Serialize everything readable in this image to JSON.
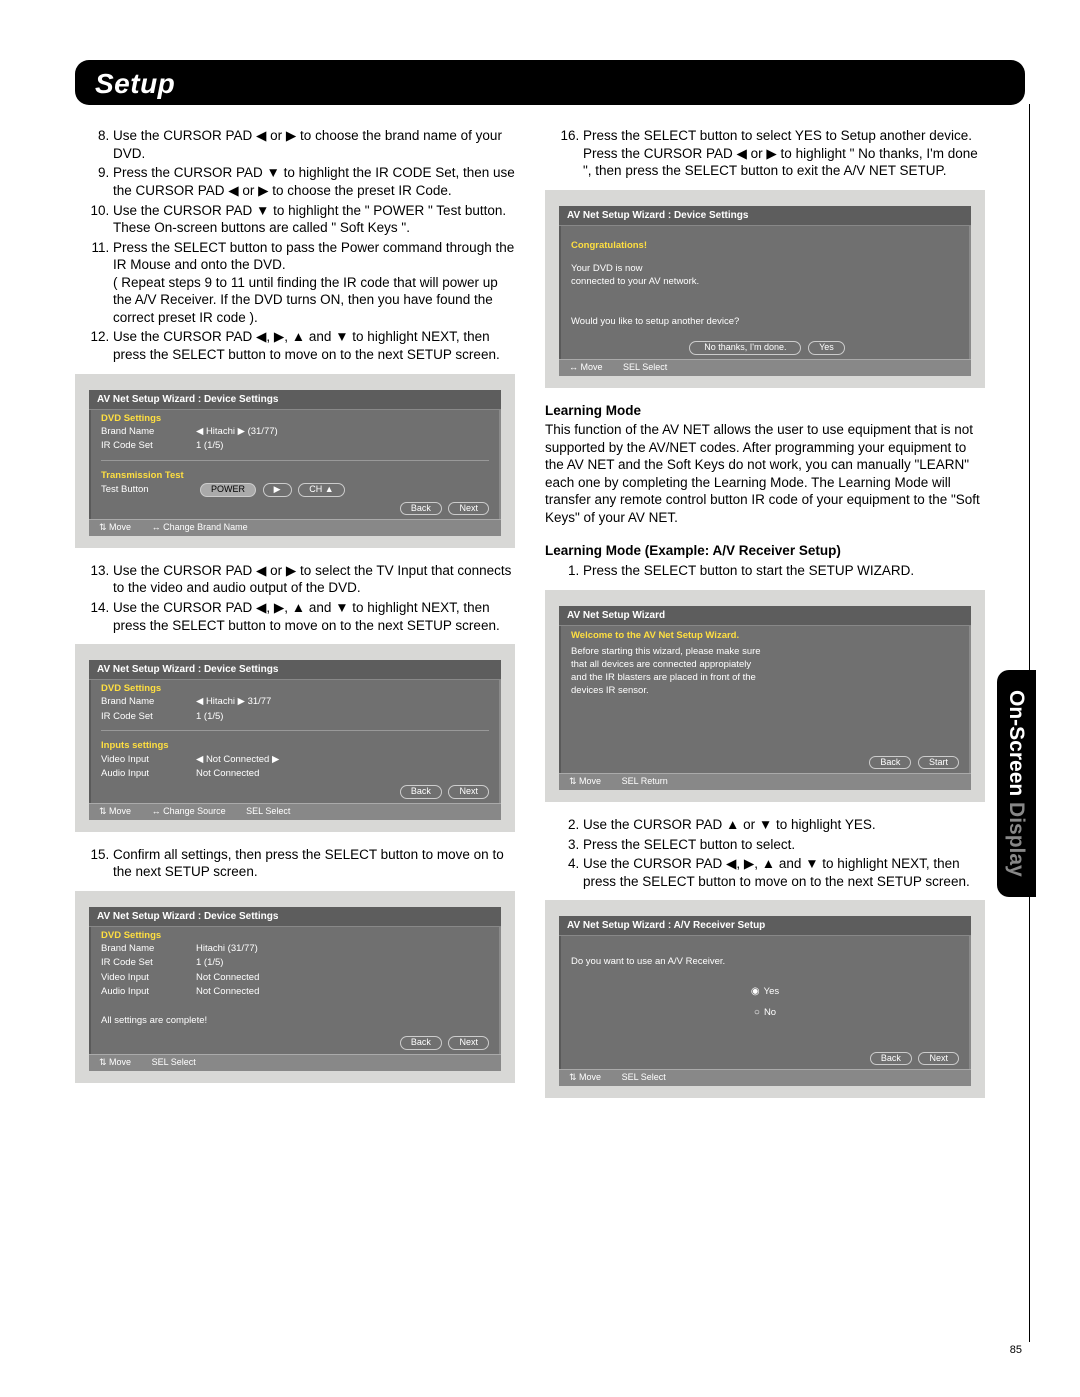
{
  "header": "Setup",
  "side_tab_a": "On-Screen",
  "side_tab_b": " Display",
  "page_num": "85",
  "steps_left_a": [
    "Use the CURSOR PAD ◀ or ▶ to choose the brand name of your DVD.",
    "Press the CURSOR PAD ▼ to highlight the IR CODE Set, then use the CURSOR PAD ◀ or ▶ to choose the preset IR Code.",
    "Use the CURSOR PAD ▼ to highlight the \" POWER \" Test button.",
    "Press the SELECT button to pass the Power command through the IR Mouse and onto the DVD.",
    "Use the CURSOR PAD ◀, ▶, ▲ and ▼ to highlight NEXT, then press the SELECT button to move on to the next SETUP screen."
  ],
  "step10_extra": "These On-screen buttons are called \" Soft Keys \".",
  "step11_extra": "( Repeat steps 9 to 11 until finding the IR code that will power up  the A/V Receiver. If the DVD turns ON, then you have found the correct preset IR code ).",
  "steps_left_b": [
    "Use the CURSOR PAD ◀ or ▶ to select the TV Input that connects to the video and audio output of the DVD.",
    "Use the CURSOR PAD ◀, ▶, ▲ and ▼ to highlight NEXT, then press the SELECT button to move on to the next SETUP screen."
  ],
  "steps_left_c": [
    "Confirm all settings, then  press the SELECT button to move on to the next SETUP screen."
  ],
  "step16": "Press the SELECT button to select YES to Setup another device.  Press the CURSOR PAD ◀ or ▶ to highlight \" No thanks, I'm done \", then press the SELECT button to exit the A/V NET SETUP.",
  "learning_title": "Learning Mode",
  "learning_body": "This function of the AV NET allows the user to  use equipment that is not supported by the AV/NET codes.  After programming your equipment to the AV NET and the Soft Keys do not work, you can manually \"LEARN\" each one by completing the Learning Mode.  The Learning Mode will transfer any remote control button IR code of your equipment to the \"Soft Keys\" of your AV NET.",
  "learning_ex_title": "Learning Mode (Example: A/V Receiver Setup)",
  "steps_right_a": [
    "Press the SELECT button to start the SETUP WIZARD."
  ],
  "steps_right_b": [
    "Use the CURSOR PAD ▲ or ▼ to highlight YES.",
    "Press the SELECT button to select.",
    "Use the CURSOR PAD ◀, ▶, ▲ and ▼ to highlight NEXT, then press the SELECT button to move on to the next SETUP screen."
  ],
  "shot1": {
    "title": "AV Net Setup Wizard : Device Settings",
    "sec1": "DVD Settings",
    "brand_l": "Brand Name",
    "brand_v": "◀ Hitachi  ▶  (31/77)",
    "ir_l": "IR Code Set",
    "ir_v": "1        (1/5)",
    "sec2": "Transmission Test",
    "test_l": "Test Button",
    "test_btns": [
      "POWER",
      "▶",
      "CH ▲"
    ],
    "back": "Back",
    "next": "Next",
    "foot1": "⇅  Move",
    "foot2": "↔  Change Brand Name"
  },
  "shot2": {
    "title": "AV Net Setup Wizard : Device Settings",
    "sec1": "DVD Settings",
    "brand_l": "Brand Name",
    "brand_v": "◀ Hitachi  ▶  31/77",
    "ir_l": "IR Code Set",
    "ir_v": "1        (1/5)",
    "sec2": "Inputs settings",
    "vi_l": "Video Input",
    "vi_v": "◀  Not Connected  ▶",
    "ai_l": "Audio Input",
    "ai_v": "Not Connected",
    "back": "Back",
    "next": "Next",
    "foot1": "⇅  Move",
    "foot2": "↔  Change Source",
    "foot3": "SEL  Select"
  },
  "shot3": {
    "title": "AV Net Setup Wizard : Device Settings",
    "sec1": "DVD Settings",
    "brand_l": "Brand Name",
    "brand_v": "Hitachi        (31/77)",
    "ir_l": "IR Code Set",
    "ir_v": "1      (1/5)",
    "vi_l": "Video Input",
    "vi_v": "Not Connected",
    "ai_l": "Audio Input",
    "ai_v": "Not Connected",
    "msg": "All settings are complete!",
    "back": "Back",
    "next": "Next",
    "foot1": "⇅  Move",
    "foot2": "SEL  Select"
  },
  "shot4": {
    "title": "AV Net Setup Wizard : Device Settings",
    "l1": "Congratulations!",
    "l2": "Your DVD is now",
    "l3": "connected to your AV network.",
    "q": "Would you like to setup another device?",
    "b1": "No thanks, I'm done.",
    "b2": "Yes",
    "foot1": "↔ Move",
    "foot2": "SEL  Select"
  },
  "shot5": {
    "title": "AV Net Setup Wizard",
    "l1": "Welcome to the AV Net Setup Wizard.",
    "l2": "Before starting this wizard, please make sure",
    "l3": "that all devices are connected appropiately",
    "l4": "and the IR blasters are placed in front of the",
    "l5": "devices IR sensor.",
    "back": "Back",
    "start": "Start",
    "foot1": "⇅  Move",
    "foot2": "SEL  Return"
  },
  "shot6": {
    "title": "AV Net Setup Wizard : A/V Receiver Setup",
    "q": "Do you want to use an A/V Receiver.",
    "yes": "Yes",
    "no": "No",
    "back": "Back",
    "next": "Next",
    "foot1": "⇅  Move",
    "foot2": "SEL  Select"
  }
}
